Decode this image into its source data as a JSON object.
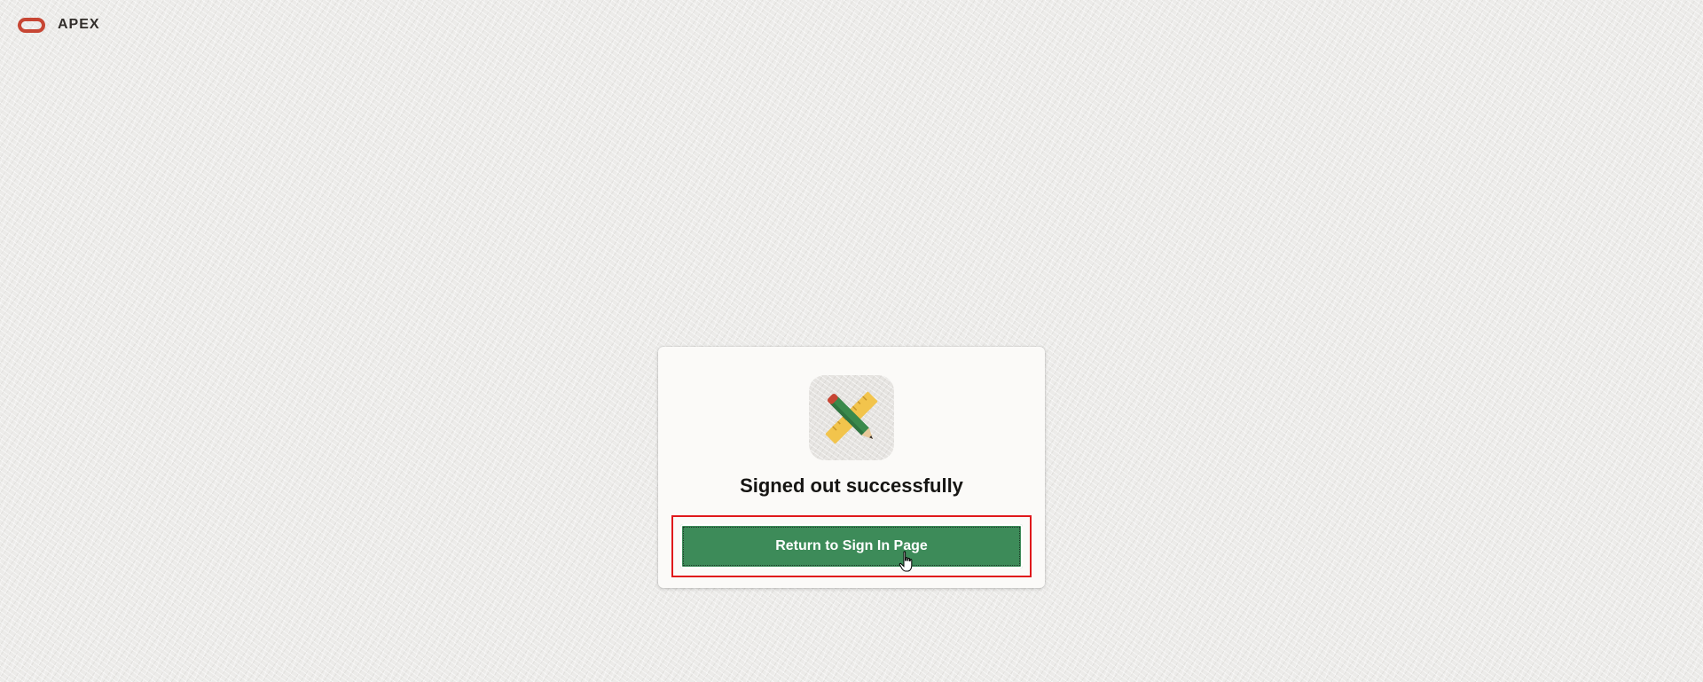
{
  "header": {
    "logo_icon": "oracle-logo-icon",
    "brand": "APEX",
    "brand_color": "#c74634"
  },
  "card": {
    "icon": "pencil-ruler-icon",
    "message": "Signed out successfully",
    "button_label": "Return to Sign In Page",
    "button_color": "#3d8b59"
  },
  "pointer": {
    "icon": "hand-pointer-icon"
  }
}
